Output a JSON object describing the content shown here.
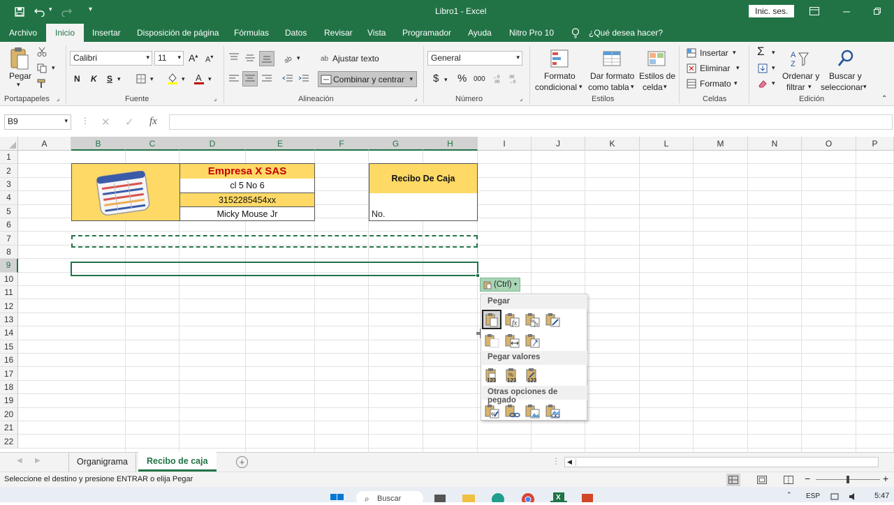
{
  "title_bar": {
    "window_title": "Libro1  -  Excel",
    "signin_label": "Inic. ses."
  },
  "tabs": [
    "Archivo",
    "Inicio",
    "Insertar",
    "Disposición de página",
    "Fórmulas",
    "Datos",
    "Revisar",
    "Vista",
    "Programador",
    "Ayuda",
    "Nitro Pro 10"
  ],
  "tell_me": "¿Qué desea hacer?",
  "ribbon": {
    "clipboard": {
      "paste_label": "Pegar",
      "group": "Portapapeles"
    },
    "font": {
      "name": "Calibri",
      "size": "11",
      "bold": "N",
      "italic": "K",
      "underline": "S",
      "group": "Fuente"
    },
    "alignment": {
      "wrap": "Ajustar texto",
      "merge": "Combinar y centrar",
      "group": "Alineación"
    },
    "number": {
      "format": "General",
      "group": "Número",
      "currency": "$",
      "percent": "%",
      "thousands": "000"
    },
    "styles": {
      "conditional_1": "Formato",
      "conditional_2": "condicional",
      "table_1": "Dar formato",
      "table_2": "como tabla",
      "cell_1": "Estilos de",
      "cell_2": "celda",
      "group": "Estilos"
    },
    "cells": {
      "insert": "Insertar",
      "delete": "Eliminar",
      "format": "Formato",
      "group": "Celdas"
    },
    "editing": {
      "sort_1": "Ordenar y",
      "sort_2": "filtrar",
      "find_1": "Buscar y",
      "find_2": "seleccionar",
      "group": "Edición"
    }
  },
  "formula_bar": {
    "name_box": "B9",
    "fx": "fx",
    "value": ""
  },
  "columns": [
    "A",
    "B",
    "C",
    "D",
    "E",
    "F",
    "G",
    "H",
    "I",
    "J",
    "K",
    "L",
    "M",
    "N",
    "O",
    "P"
  ],
  "rows": [
    "1",
    "2",
    "3",
    "4",
    "5",
    "6",
    "7",
    "8",
    "9",
    "10",
    "11",
    "12",
    "13",
    "14",
    "15",
    "16",
    "17",
    "18",
    "19",
    "20",
    "21",
    "22"
  ],
  "cells": {
    "company": "Empresa X SAS",
    "address": "cl 5 No 6",
    "phone": "3152285454xx",
    "person": "Micky Mouse Jr",
    "receipt_title": "Recibo De  Caja",
    "receipt_no": "No."
  },
  "paste_options": {
    "tag_label": "(Ctrl)",
    "section_paste": "Pegar",
    "section_values": "Pegar valores",
    "section_other": "Otras opciones de pegado",
    "values_badge": "123"
  },
  "sheets": [
    "Organigrama",
    "Recibo de caja"
  ],
  "active_sheet": "Recibo de caja",
  "status": {
    "message": "Seleccione el destino y presione ENTRAR o elija Pegar"
  },
  "taskbar": {
    "search": "Buscar",
    "lang": "ESP",
    "time": "5:47"
  },
  "colors": {
    "excel_green": "#217346",
    "header_fill": "#ffd966",
    "company_red": "#c00000"
  }
}
